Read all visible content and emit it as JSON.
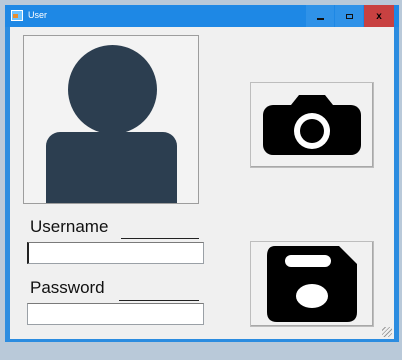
{
  "window": {
    "title": "User",
    "controls": {
      "minimize": "minimize",
      "maximize": "maximize",
      "close": "x"
    }
  },
  "form": {
    "avatar_icon": "user-silhouette-icon",
    "username_label": "Username",
    "username_value": "",
    "password_label": "Password",
    "password_value": ""
  },
  "buttons": {
    "camera_icon": "camera-icon",
    "save_icon": "floppy-disk-icon"
  },
  "colors": {
    "titlebar": "#1e88e5",
    "close": "#c84141",
    "icon_dark": "#2c3e50",
    "tool_icon": "#000000"
  }
}
